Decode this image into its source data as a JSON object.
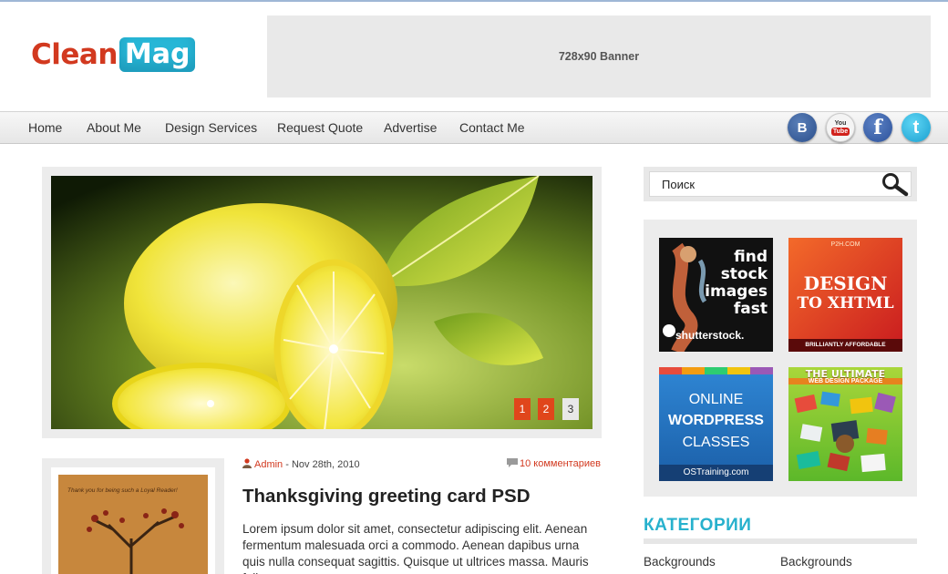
{
  "header": {
    "logo_part1": "Clean",
    "logo_part2": "Mag",
    "banner_label": "728x90 Banner"
  },
  "nav": {
    "items": [
      "Home",
      "About Me",
      "Design Services",
      "Request Quote",
      "Advertise",
      "Contact Me"
    ]
  },
  "social": {
    "vk_label": "B",
    "youtube_label_top": "You",
    "youtube_label_bottom": "Tube",
    "facebook_label": "f",
    "twitter_label": "t"
  },
  "slider": {
    "pages": [
      "1",
      "2",
      "3"
    ],
    "active_page": "3"
  },
  "post": {
    "thumb_text": "Thank you for being such a Loyal Reader!",
    "author": "Admin",
    "date_separator": " - ",
    "date": "Nov 28th, 2010",
    "comments": "10 комментариев",
    "title": "Thanksgiving greeting card PSD",
    "excerpt": "Lorem ipsum dolor sit amet, consectetur adipiscing elit. Aenean fermentum malesuada orci a commodo. Aenean dapibus urna quis nulla consequat sagittis. Quisque ut ultrices massa. Mauris felis"
  },
  "sidebar": {
    "search_placeholder": "Поиск",
    "ads": {
      "shutterstock": [
        "find",
        "stock",
        "images",
        "fast",
        "shutterstock."
      ],
      "p2h": [
        "P2H.COM",
        "DESIGN",
        "TO XHTML",
        "BRILLIANTLY AFFORDABLE"
      ],
      "ostraining": [
        "ONLINE",
        "WORDPRESS",
        "CLASSES",
        "OSTraining.com"
      ],
      "webdesign": [
        "THE ULTIMATE",
        "WEB DESIGN PACKAGE"
      ]
    },
    "categories_title": "КАТЕГОРИИ",
    "categories": [
      "Backgrounds",
      "Backgrounds"
    ]
  },
  "colors": {
    "accent_red": "#d2391f",
    "accent_cyan": "#27b6d6",
    "pager_active": "#e0461b"
  }
}
